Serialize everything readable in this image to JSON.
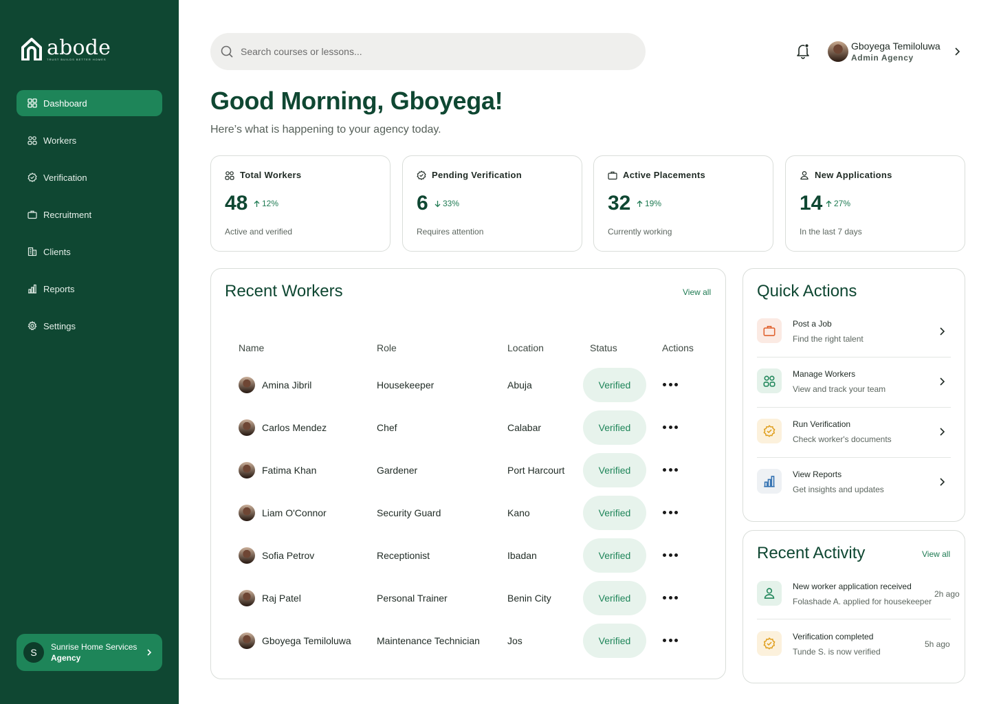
{
  "brand": {
    "name": "abode",
    "tagline": "TRUST BUILDS BETTER HOMES"
  },
  "sidebar": {
    "items": [
      {
        "label": "Dashboard",
        "icon": "grid-icon",
        "active": true
      },
      {
        "label": "Workers",
        "icon": "users-icon"
      },
      {
        "label": "Verification",
        "icon": "badge-check-icon"
      },
      {
        "label": "Recruitment",
        "icon": "briefcase-icon"
      },
      {
        "label": "Clients",
        "icon": "building-icon"
      },
      {
        "label": "Reports",
        "icon": "bar-chart-icon"
      },
      {
        "label": "Settings",
        "icon": "gear-icon"
      }
    ],
    "agency": {
      "initial": "S",
      "name": "Sunrise Home Services",
      "type": "Agency"
    }
  },
  "header": {
    "search_placeholder": "Search courses or lessons...",
    "user": {
      "name": "Gboyega Temiloluwa",
      "role": "Admin Agency"
    }
  },
  "greeting": {
    "title": "Good Morning, Gboyega!",
    "subtitle": "Here’s what is happening to your agency today."
  },
  "stats": [
    {
      "label": "Total Workers",
      "value": "48",
      "delta": "12%",
      "direction": "up",
      "desc": "Active and verified",
      "icon": "users-icon"
    },
    {
      "label": "Pending Verification",
      "value": "6",
      "delta": "33%",
      "direction": "down",
      "desc": "Requires attention",
      "icon": "badge-check-icon"
    },
    {
      "label": "Active Placements",
      "value": "32",
      "delta": "19%",
      "direction": "up",
      "desc": "Currently working",
      "icon": "briefcase-icon"
    },
    {
      "label": "New Applications",
      "value": "14",
      "delta": "27%",
      "direction": "up",
      "desc": "In the last 7 days",
      "icon": "user-icon"
    }
  ],
  "recent_workers": {
    "title": "Recent Workers",
    "view_all": "View all",
    "columns": [
      "Name",
      "Role",
      "Location",
      "Status",
      "Actions"
    ],
    "rows": [
      {
        "name": "Amina Jibril",
        "role": "Housekeeper",
        "location": "Abuja",
        "status": "Verified"
      },
      {
        "name": "Carlos Mendez",
        "role": "Chef",
        "location": "Calabar",
        "status": "Verified"
      },
      {
        "name": "Fatima Khan",
        "role": "Gardener",
        "location": "Port Harcourt",
        "status": "Verified"
      },
      {
        "name": "Liam O'Connor",
        "role": "Security Guard",
        "location": "Kano",
        "status": "Verified"
      },
      {
        "name": "Sofia Petrov",
        "role": "Receptionist",
        "location": "Ibadan",
        "status": "Verified"
      },
      {
        "name": "Raj Patel",
        "role": "Personal Trainer",
        "location": "Benin City",
        "status": "Verified"
      },
      {
        "name": "Gboyega Temiloluwa",
        "role": "Maintenance Technician",
        "location": "Jos",
        "status": "Verified"
      }
    ]
  },
  "quick_actions": {
    "title": "Quick Actions",
    "items": [
      {
        "title": "Post a Job",
        "subtitle": "Find the right talent",
        "icon": "briefcase-icon",
        "color": "#e0612e",
        "bg": "#fbeae3"
      },
      {
        "title": "Manage Workers",
        "subtitle": "View and track your team",
        "icon": "users-icon",
        "color": "#1e8559",
        "bg": "#e4f2ea"
      },
      {
        "title": "Run Verification",
        "subtitle": "Check worker's documents",
        "icon": "badge-check-icon",
        "color": "#e0a020",
        "bg": "#fcf1dc"
      },
      {
        "title": "View Reports",
        "subtitle": "Get insights and updates",
        "icon": "bar-chart-icon",
        "color": "#2f6fb0",
        "bg": "#eef1f4"
      }
    ]
  },
  "recent_activity": {
    "title": "Recent Activity",
    "view_all": "View all",
    "items": [
      {
        "title": "New worker application received",
        "subtitle": "Folashade A. applied for housekeeper",
        "time": "2h ago",
        "icon": "user-icon",
        "color": "#1e8559",
        "bg": "#e4f2ea"
      },
      {
        "title": "Verification completed",
        "subtitle": "Tunde S. is now verified",
        "time": "5h ago",
        "icon": "badge-check-icon",
        "color": "#e0a020",
        "bg": "#fcf1dc"
      }
    ]
  }
}
